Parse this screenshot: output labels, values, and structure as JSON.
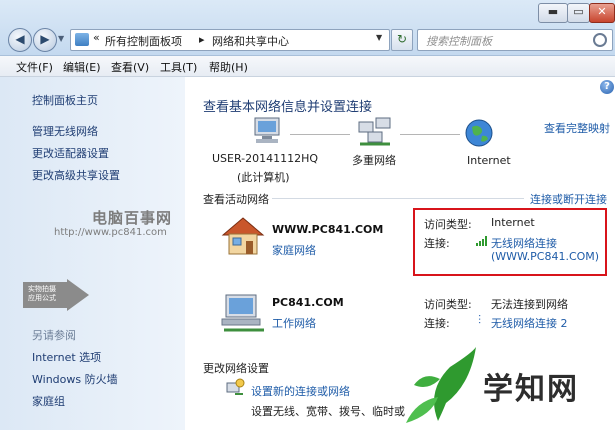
{
  "window": {
    "min_label": "▬",
    "max_label": "▭",
    "close_label": "✕"
  },
  "address": {
    "sep": "«",
    "crumbs": [
      "所有控制面板项",
      "▸",
      "网络和共享中心"
    ],
    "search_placeholder": "搜索控制面板"
  },
  "menu": [
    "文件(F)",
    "编辑(E)",
    "查看(V)",
    "工具(T)",
    "帮助(H)"
  ],
  "sidebar": {
    "links": [
      "控制面板主页",
      "管理无线网络",
      "更改适配器设置",
      "更改高级共享设置"
    ],
    "see_also_title": "另请参阅",
    "see_also": [
      "Internet 选项",
      "Windows 防火墙",
      "家庭组"
    ],
    "watermark_badge": [
      "实物拍摄",
      "应用公式"
    ],
    "watermark_title": "电脑百事网",
    "watermark_url": "http://www.pc841.com"
  },
  "main": {
    "title": "查看基本网络信息并设置连接",
    "full_map": "查看完整映射",
    "nodes": [
      {
        "label": "USER-20141112HQ",
        "sub": "(此计算机)"
      },
      {
        "label": "多重网络",
        "sub": ""
      },
      {
        "label": "Internet",
        "sub": ""
      }
    ],
    "active_head": "查看活动网络",
    "connect_link": "连接或断开连接",
    "networks": [
      {
        "name": "WWW.PC841.COM",
        "type": "家庭网络",
        "access_label": "访问类型:",
        "access_value": "Internet",
        "conn_label": "连接:",
        "conn_value": "无线网络连接",
        "conn_value2": "(WWW.PC841.COM)"
      },
      {
        "name": "PC841.COM",
        "type": "工作网络",
        "access_label": "访问类型:",
        "access_value": "无法连接到网络",
        "conn_label": "连接:",
        "conn_value": "无线网络连接 2",
        "conn_value2": ""
      }
    ],
    "settings_head": "更改网络设置",
    "settings_link": "设置新的连接或网络",
    "settings_desc": "设置无线、宽带、拨号、临时或"
  },
  "logo": {
    "text": "学知网"
  },
  "colors": {
    "accent_link": "#1f5ca8",
    "highlight_box": "#d8141b",
    "signal": "#2f9a2f"
  }
}
